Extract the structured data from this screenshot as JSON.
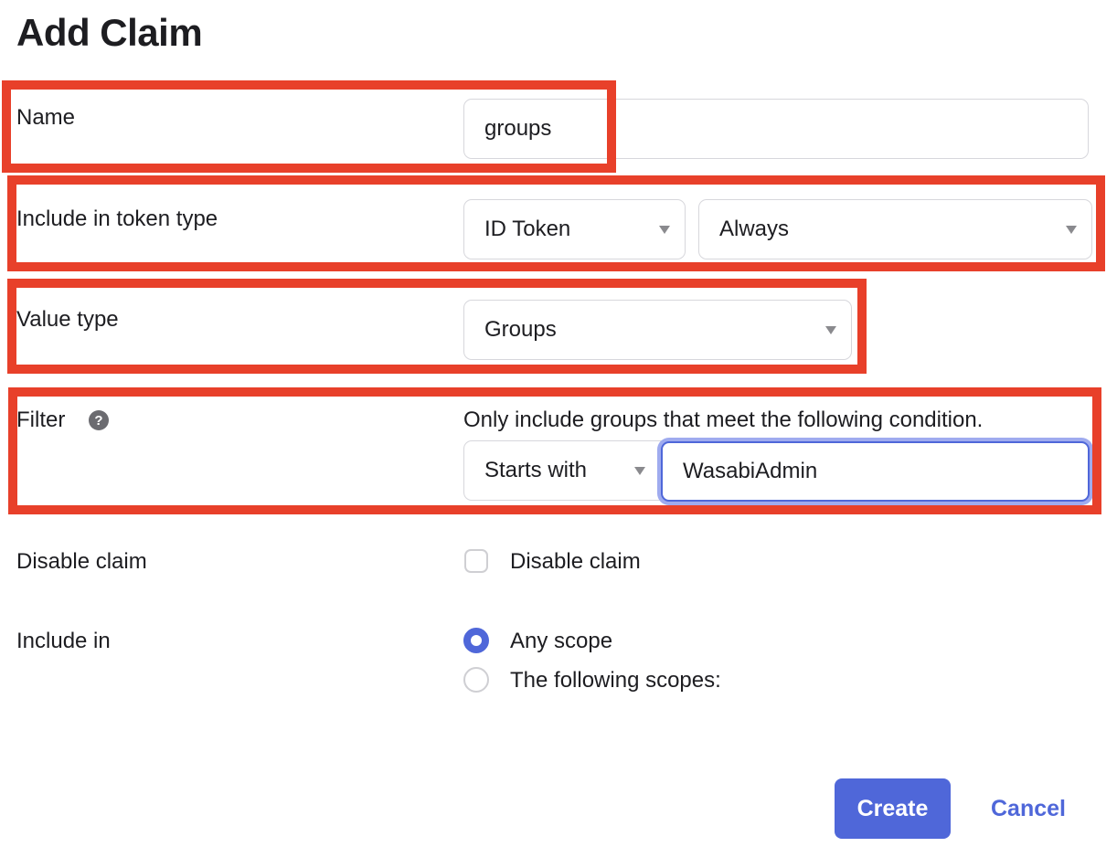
{
  "dialog": {
    "title": "Add Claim"
  },
  "fields": {
    "name": {
      "label": "Name",
      "value": "groups"
    },
    "token_type": {
      "label": "Include in token type",
      "token_select": "ID Token",
      "when_select": "Always"
    },
    "value_type": {
      "label": "Value type",
      "select": "Groups"
    },
    "filter": {
      "label": "Filter",
      "help_icon": "?",
      "description": "Only include groups that meet the following condition.",
      "operator_select": "Starts with",
      "value": "WasabiAdmin"
    },
    "disable_claim": {
      "label": "Disable claim",
      "checkbox_label": "Disable claim",
      "checked": false
    },
    "include_in": {
      "label": "Include in",
      "options": [
        {
          "label": "Any scope",
          "selected": true
        },
        {
          "label": "The following scopes:",
          "selected": false
        }
      ]
    }
  },
  "actions": {
    "create": "Create",
    "cancel": "Cancel"
  },
  "colors": {
    "accent": "#4f67d9",
    "highlight": "#e8402a",
    "focus_ring": "#9fabef"
  }
}
